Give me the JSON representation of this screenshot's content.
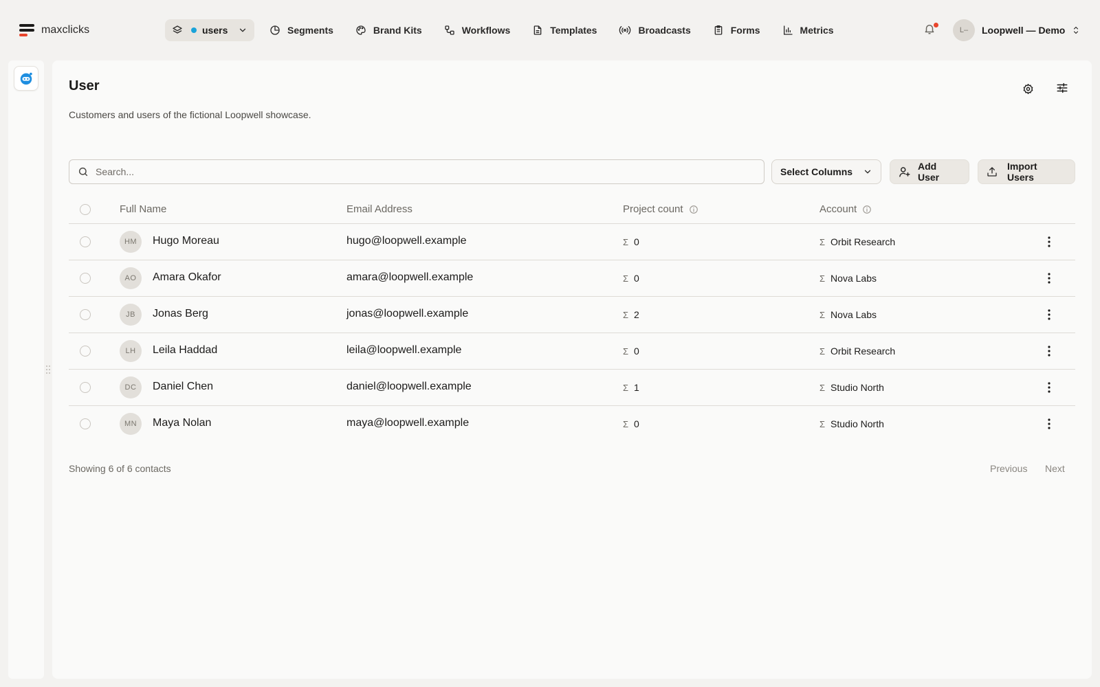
{
  "brand": {
    "name": "maxclicks"
  },
  "collection_switch": {
    "label": "users",
    "dot_color": "#1aa3d9"
  },
  "nav": {
    "items": [
      {
        "label": "Segments",
        "icon": "pie-chart-icon"
      },
      {
        "label": "Brand Kits",
        "icon": "palette-icon"
      },
      {
        "label": "Workflows",
        "icon": "workflow-icon"
      },
      {
        "label": "Templates",
        "icon": "document-icon"
      },
      {
        "label": "Broadcasts",
        "icon": "broadcast-icon"
      },
      {
        "label": "Forms",
        "icon": "clipboard-icon"
      },
      {
        "label": "Metrics",
        "icon": "bar-chart-icon"
      }
    ]
  },
  "notifications": {
    "has_unread": true,
    "badge_color": "#e8452c"
  },
  "account": {
    "initials": "L–",
    "name": "Loopwell — Demo"
  },
  "page": {
    "title": "User",
    "description": "Customers and users of the fictional Loopwell showcase."
  },
  "toolbar": {
    "search_placeholder": "Search...",
    "select_columns_label": "Select Columns",
    "add_user_label": "Add User",
    "import_users_label": "Import Users"
  },
  "table": {
    "columns": [
      "Full Name",
      "Email Address",
      "Project count",
      "Account"
    ],
    "rows": [
      {
        "initials": "HM",
        "name": "Hugo Moreau",
        "email": "hugo@loopwell.example",
        "project_count": "0",
        "account": "Orbit Research"
      },
      {
        "initials": "AO",
        "name": "Amara Okafor",
        "email": "amara@loopwell.example",
        "project_count": "0",
        "account": "Nova Labs"
      },
      {
        "initials": "JB",
        "name": "Jonas Berg",
        "email": "jonas@loopwell.example",
        "project_count": "2",
        "account": "Nova Labs"
      },
      {
        "initials": "LH",
        "name": "Leila Haddad",
        "email": "leila@loopwell.example",
        "project_count": "0",
        "account": "Orbit Research"
      },
      {
        "initials": "DC",
        "name": "Daniel Chen",
        "email": "daniel@loopwell.example",
        "project_count": "1",
        "account": "Studio North"
      },
      {
        "initials": "MN",
        "name": "Maya Nolan",
        "email": "maya@loopwell.example",
        "project_count": "0",
        "account": "Studio North"
      }
    ],
    "aggregate_symbol": "Σ"
  },
  "footer": {
    "showing_text": "Showing 6 of 6 contacts",
    "previous_label": "Previous",
    "next_label": "Next"
  }
}
